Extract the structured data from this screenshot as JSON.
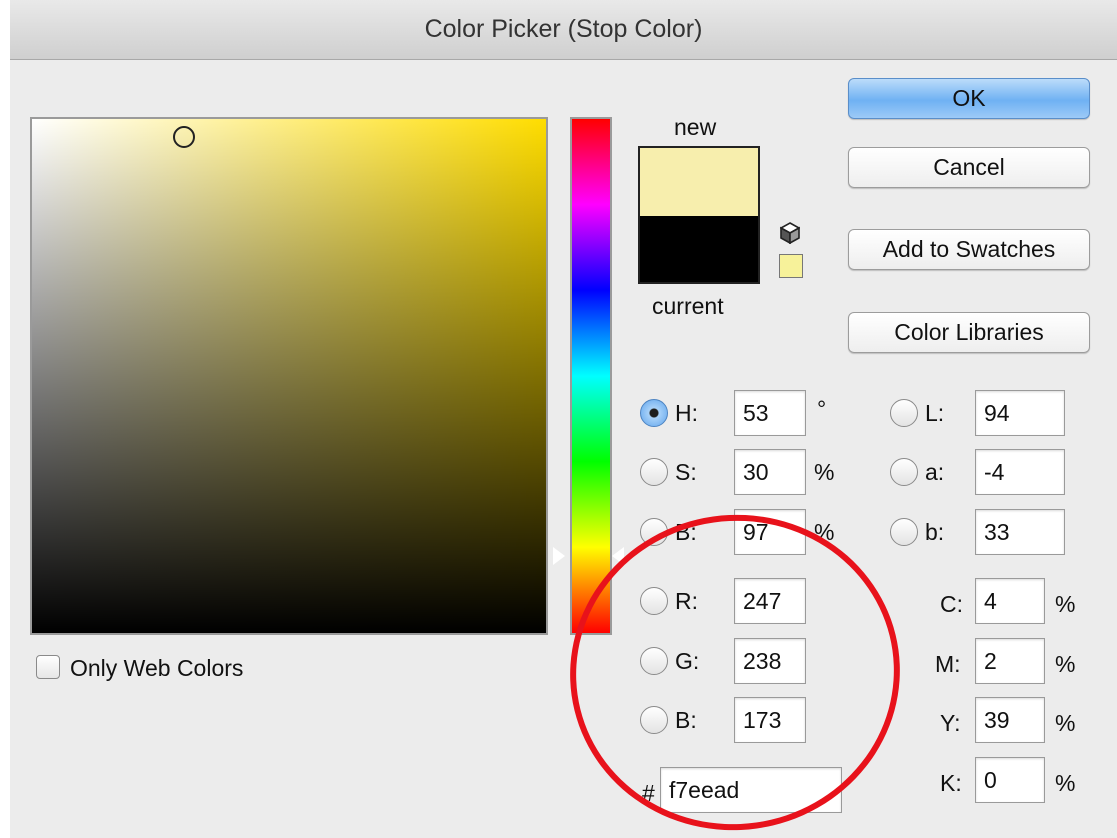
{
  "window": {
    "title": "Color Picker (Stop Color)"
  },
  "swatches": {
    "new_label": "new",
    "current_label": "current",
    "new_color": "#f7eead",
    "current_color": "#000000",
    "gamut_color": "#f7f29a"
  },
  "buttons": {
    "ok": "OK",
    "cancel": "Cancel",
    "add_to_swatches": "Add to Swatches",
    "color_libraries": "Color Libraries"
  },
  "hsb": {
    "h": {
      "label": "H:",
      "value": "53",
      "unit": "°",
      "checked": true
    },
    "s": {
      "label": "S:",
      "value": "30",
      "unit": "%"
    },
    "b": {
      "label": "B:",
      "value": "97",
      "unit": "%"
    }
  },
  "rgb": {
    "r": {
      "label": "R:",
      "value": "247"
    },
    "g": {
      "label": "G:",
      "value": "238"
    },
    "b": {
      "label": "B:",
      "value": "173"
    }
  },
  "lab": {
    "l": {
      "label": "L:",
      "value": "94"
    },
    "a": {
      "label": "a:",
      "value": "-4"
    },
    "b": {
      "label": "b:",
      "value": "33"
    }
  },
  "cmyk": {
    "c": {
      "label": "C:",
      "value": "4",
      "unit": "%"
    },
    "m": {
      "label": "M:",
      "value": "2",
      "unit": "%"
    },
    "y": {
      "label": "Y:",
      "value": "39",
      "unit": "%"
    },
    "k": {
      "label": "K:",
      "value": "0",
      "unit": "%"
    }
  },
  "hex": {
    "label": "#",
    "value": "f7eead"
  },
  "options": {
    "only_web_colors": "Only Web Colors"
  },
  "annotation": {
    "color": "#e8121b"
  },
  "icons": {
    "gamut_warning": "cube-icon"
  }
}
